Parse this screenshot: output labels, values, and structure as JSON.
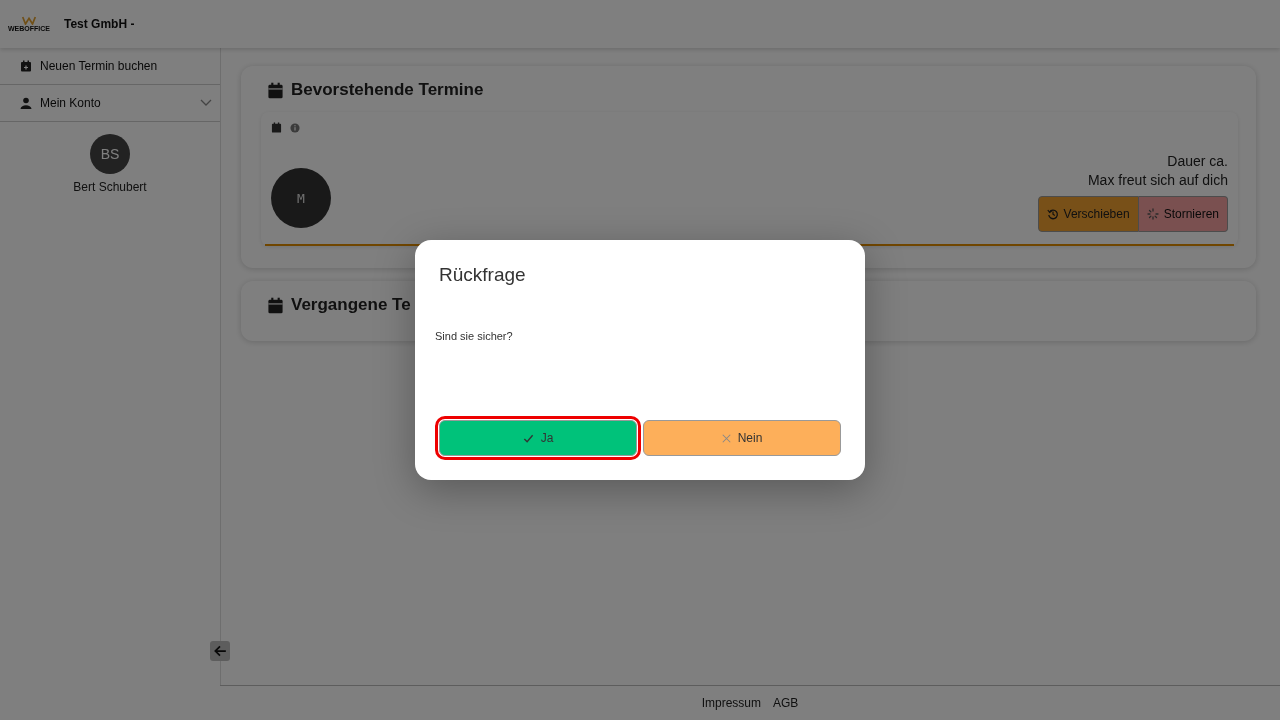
{
  "header": {
    "logo_text": "WEBOFFICE",
    "title": "Test GmbH -"
  },
  "sidebar": {
    "items": [
      {
        "kind": "link",
        "label": "Neuen Termin buchen"
      },
      {
        "kind": "menu",
        "label": "Mein Konto",
        "expanded": false
      }
    ],
    "user": {
      "initials": "BS",
      "name": "Bert Schubert"
    }
  },
  "upcoming": {
    "title": "Bevorstehende Termine",
    "appointment": {
      "initials": "M",
      "duration": "Dauer ca.",
      "message": "Max freut sich auf dich",
      "buttons": [
        {
          "kind": "reschedule",
          "label": "Verschieben",
          "disabled": false
        },
        {
          "kind": "cancel",
          "label": "Stornieren",
          "disabled": true
        }
      ]
    }
  },
  "past": {
    "title": "Vergangene Te"
  },
  "footer": {
    "links": [
      "Impressum",
      "AGB"
    ]
  },
  "dialog": {
    "title": "Rückfrage",
    "message": "Sind sie sicher?",
    "buttons": [
      {
        "kind": "yes",
        "label": "Ja",
        "focused": true
      },
      {
        "kind": "no",
        "label": "Nein",
        "focused": false
      }
    ]
  }
}
